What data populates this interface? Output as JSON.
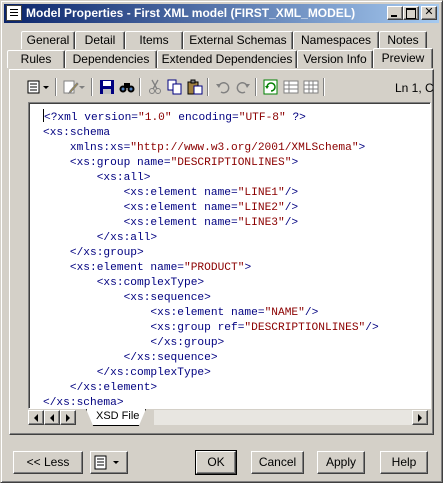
{
  "window": {
    "title": "Model Properties - First XML model (FIRST_XML_MODEL)"
  },
  "tabs": {
    "row1": [
      "General",
      "Detail",
      "Items",
      "External Schemas",
      "Namespaces",
      "Notes"
    ],
    "row2": [
      "Rules",
      "Dependencies",
      "Extended Dependencies",
      "Version Info",
      "Preview"
    ],
    "active": "Preview"
  },
  "toolbar": {
    "icons": [
      "properties-icon",
      "edit-icon",
      "save-icon",
      "find-icon",
      "cut-icon",
      "copy-icon",
      "paste-icon",
      "undo-icon",
      "redo-icon",
      "refresh-icon",
      "table-icon",
      "grid-icon"
    ],
    "position": "Ln 1, C"
  },
  "editor": {
    "lines": [
      [
        [
          "k",
          "<?xml "
        ],
        [
          "k",
          "version="
        ],
        [
          "s",
          "\"1.0\""
        ],
        [
          "k",
          " encoding="
        ],
        [
          "s",
          "\"UTF-8\""
        ],
        [
          "k",
          " ?>"
        ]
      ],
      [
        [
          "k",
          "<xs:schema"
        ]
      ],
      [
        [
          "k",
          "    xmlns:xs="
        ],
        [
          "s",
          "\"http://www.w3.org/2001/XMLSchema\""
        ],
        [
          "k",
          ">"
        ]
      ],
      [
        [
          "k",
          "    <xs:group "
        ],
        [
          "k",
          "name="
        ],
        [
          "s",
          "\"DESCRIPTIONLINES\""
        ],
        [
          "k",
          ">"
        ]
      ],
      [
        [
          "k",
          "        <xs:all>"
        ]
      ],
      [
        [
          "k",
          "            <xs:element "
        ],
        [
          "k",
          "name="
        ],
        [
          "s",
          "\"LINE1\""
        ],
        [
          "k",
          "/>"
        ]
      ],
      [
        [
          "k",
          "            <xs:element "
        ],
        [
          "k",
          "name="
        ],
        [
          "s",
          "\"LINE2\""
        ],
        [
          "k",
          "/>"
        ]
      ],
      [
        [
          "k",
          "            <xs:element "
        ],
        [
          "k",
          "name="
        ],
        [
          "s",
          "\"LINE3\""
        ],
        [
          "k",
          "/>"
        ]
      ],
      [
        [
          "k",
          "        </xs:all>"
        ]
      ],
      [
        [
          "k",
          "    </xs:group>"
        ]
      ],
      [
        [
          "k",
          "    <xs:element "
        ],
        [
          "k",
          "name="
        ],
        [
          "s",
          "\"PRODUCT\""
        ],
        [
          "k",
          ">"
        ]
      ],
      [
        [
          "k",
          "        <xs:complexType>"
        ]
      ],
      [
        [
          "k",
          "            <xs:sequence>"
        ]
      ],
      [
        [
          "k",
          "                <xs:element "
        ],
        [
          "k",
          "name="
        ],
        [
          "s",
          "\"NAME\""
        ],
        [
          "k",
          "/>"
        ]
      ],
      [
        [
          "k",
          "                <xs:group "
        ],
        [
          "k",
          "ref="
        ],
        [
          "s",
          "\"DESCRIPTIONLINES\""
        ],
        [
          "k",
          "/>"
        ]
      ],
      [
        [
          "k",
          "                </xs:group>"
        ]
      ],
      [
        [
          "k",
          "            </xs:sequence>"
        ]
      ],
      [
        [
          "k",
          "        </xs:complexType>"
        ]
      ],
      [
        [
          "k",
          "    </xs:element>"
        ]
      ],
      [
        [
          "k",
          "</xs:schema>"
        ]
      ]
    ],
    "sheet_tab": "XSD File"
  },
  "buttons": {
    "less": "<< Less",
    "ok": "OK",
    "cancel": "Cancel",
    "apply": "Apply",
    "help": "Help"
  },
  "colors": {
    "tag": "#000080",
    "string": "#8b0000",
    "title_start": "#0a246a",
    "title_end": "#a6caf0"
  }
}
